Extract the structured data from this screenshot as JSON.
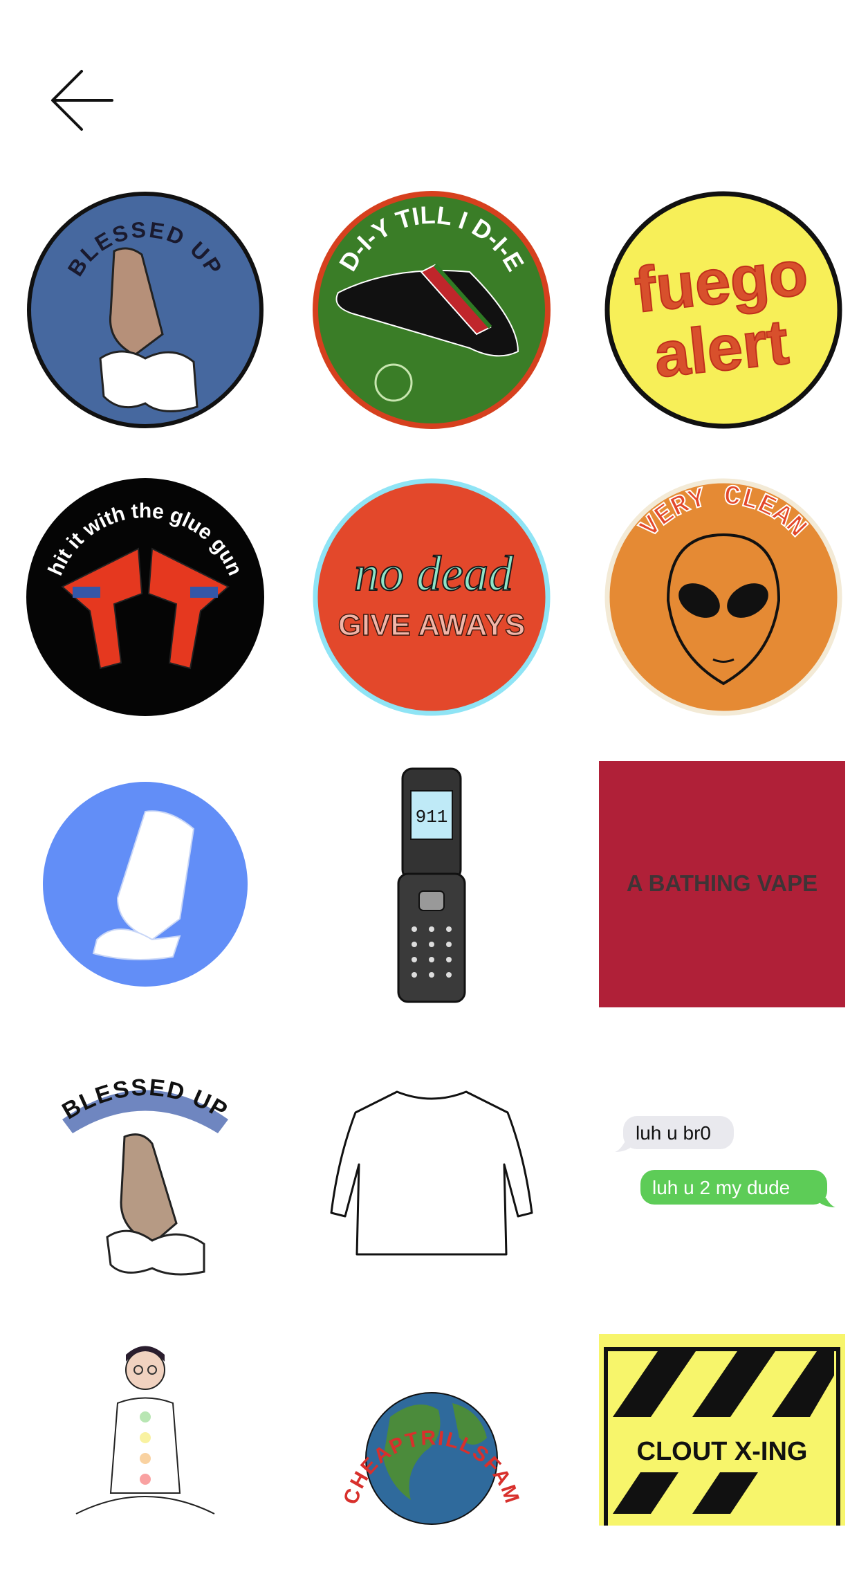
{
  "header": {
    "back_icon": "arrow-left-icon"
  },
  "stickers": [
    {
      "name": "blessed-up-badge",
      "text": "BLESSED UP"
    },
    {
      "name": "diy-till-i-die-badge",
      "text": "D-I-Y TILL I D-I-E"
    },
    {
      "name": "fuego-alert-badge",
      "line1": "fuego",
      "line2": "alert"
    },
    {
      "name": "glue-gun-badge",
      "text": "hit it with the glue gun"
    },
    {
      "name": "no-dead-giveaways-badge",
      "line1": "no dead",
      "line2": "GIVE AWAYS"
    },
    {
      "name": "very-clean-alien-badge",
      "text": "VERY CLEAN"
    },
    {
      "name": "praying-hands-blue-sticker"
    },
    {
      "name": "flip-phone-sticker",
      "screen_text": "911"
    },
    {
      "name": "a-bathing-vape-sticker",
      "text": "A BATHING VAPE"
    },
    {
      "name": "blessed-up-hands-sticker",
      "text": "BLESSED UP"
    },
    {
      "name": "long-sleeve-shirt-sticker"
    },
    {
      "name": "text-messages-sticker",
      "received": "luh u br0",
      "sent": "luh u 2 my dude"
    },
    {
      "name": "meditating-person-sticker"
    },
    {
      "name": "globe-sticker",
      "text": "CHEAPTRILLSFAM"
    },
    {
      "name": "clout-xing-sticker",
      "text": "CLOUT X-ING"
    }
  ],
  "colors": {
    "blue_badge": "#46689f",
    "green_badge": "#3a7d27",
    "yellow_badge": "#f7ef58",
    "red_orange": "#e3482b",
    "orange": "#e58a34",
    "light_blue": "#628ef7",
    "burgundy": "#b02038",
    "sms_green": "#5dcc57"
  }
}
